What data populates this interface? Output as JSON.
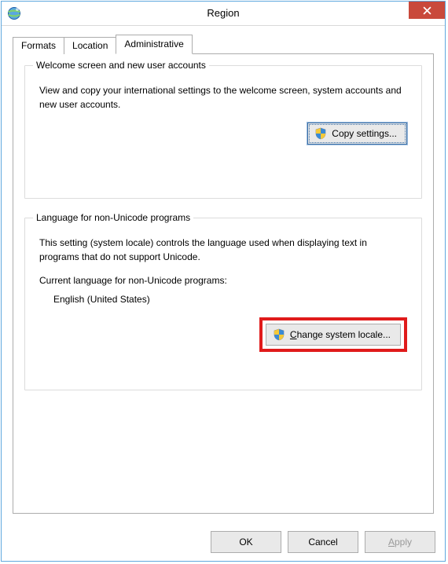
{
  "window": {
    "title": "Region"
  },
  "tabs": {
    "formats": "Formats",
    "location": "Location",
    "administrative": "Administrative"
  },
  "group1": {
    "legend": "Welcome screen and new user accounts",
    "desc": "View and copy your international settings to the welcome screen, system accounts and new user accounts.",
    "copy_btn": "Copy settings..."
  },
  "group2": {
    "legend": "Language for non-Unicode programs",
    "desc": "This setting (system locale) controls the language used when displaying text in programs that do not support Unicode.",
    "current_label": "Current language for non-Unicode programs:",
    "current_value": "English (United States)",
    "change_btn": "Change system locale..."
  },
  "buttons": {
    "ok": "OK",
    "cancel": "Cancel",
    "apply": "Apply"
  }
}
